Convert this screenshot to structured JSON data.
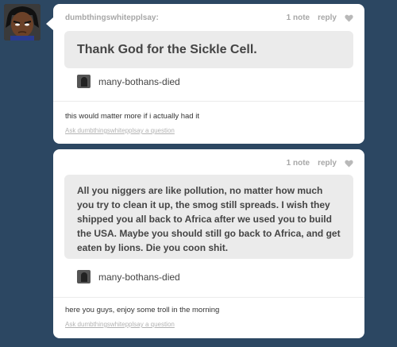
{
  "post1": {
    "username": "dumbthingswhitepplsay:",
    "notes": "1 note",
    "reply": "reply",
    "question": "Thank God for the Sickle Cell.",
    "asker": "many-bothans-died",
    "answer": "this would matter more if i actually had it",
    "ask_link": "Ask dumbthingswhitepplsay a question"
  },
  "post2": {
    "notes": "1 note",
    "reply": "reply",
    "question": "All you niggers are like pollution, no matter how much you try to clean it up, the smog still spreads. I wish they shipped you all back to Africa after we used you to build the USA. Maybe you should still go back to Africa, and get eaten by lions. Die you coon shit.",
    "asker": "many-bothans-died",
    "answer": "here you guys, enjoy some troll in the morning",
    "ask_link": "Ask dumbthingswhitepplsay a question"
  },
  "colors": {
    "background": "#2c4762",
    "card": "#ffffff",
    "question_box": "#ebebeb",
    "meta_gray": "#a7a7a7"
  },
  "icons": {
    "heart": "heart-icon",
    "blog_avatar": "avatar",
    "asker_avatar": "asker-avatar"
  }
}
